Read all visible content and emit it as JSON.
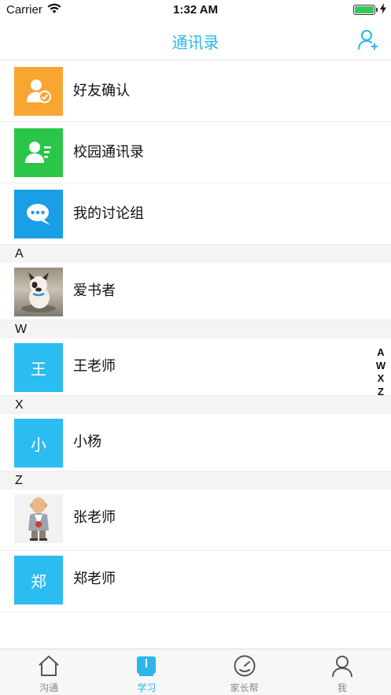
{
  "status_bar": {
    "carrier": "Carrier",
    "time": "1:32 AM"
  },
  "nav": {
    "title": "通讯录",
    "add_icon": "add-contact-icon"
  },
  "accent_color": "#2bb7e9",
  "menu": [
    {
      "label": "好友确认",
      "icon": "friend-confirm-icon",
      "color": "#f8a531"
    },
    {
      "label": "校园通讯录",
      "icon": "campus-contacts-icon",
      "color": "#2bc54a"
    },
    {
      "label": "我的讨论组",
      "icon": "chat-bubble-icon",
      "color": "#1a9ee6"
    }
  ],
  "sections": [
    {
      "letter": "A",
      "contacts": [
        {
          "name": "爱书者",
          "avatar": "dog-photo"
        }
      ]
    },
    {
      "letter": "W",
      "contacts": [
        {
          "name": "王老师",
          "avatar_text": "王"
        }
      ]
    },
    {
      "letter": "X",
      "contacts": [
        {
          "name": "小杨",
          "avatar_text": "小"
        }
      ]
    },
    {
      "letter": "Z",
      "contacts": [
        {
          "name": "张老师",
          "avatar": "man-cartoon"
        },
        {
          "name": "郑老师",
          "avatar_text": "郑"
        }
      ]
    }
  ],
  "index": [
    "A",
    "W",
    "X",
    "Z"
  ],
  "tabs": [
    {
      "label": "沟通",
      "icon": "home-icon",
      "active": false
    },
    {
      "label": "学习",
      "icon": "book-icon",
      "active": true
    },
    {
      "label": "家长帮",
      "icon": "gauge-icon",
      "active": false
    },
    {
      "label": "我",
      "icon": "person-icon",
      "active": false
    }
  ]
}
